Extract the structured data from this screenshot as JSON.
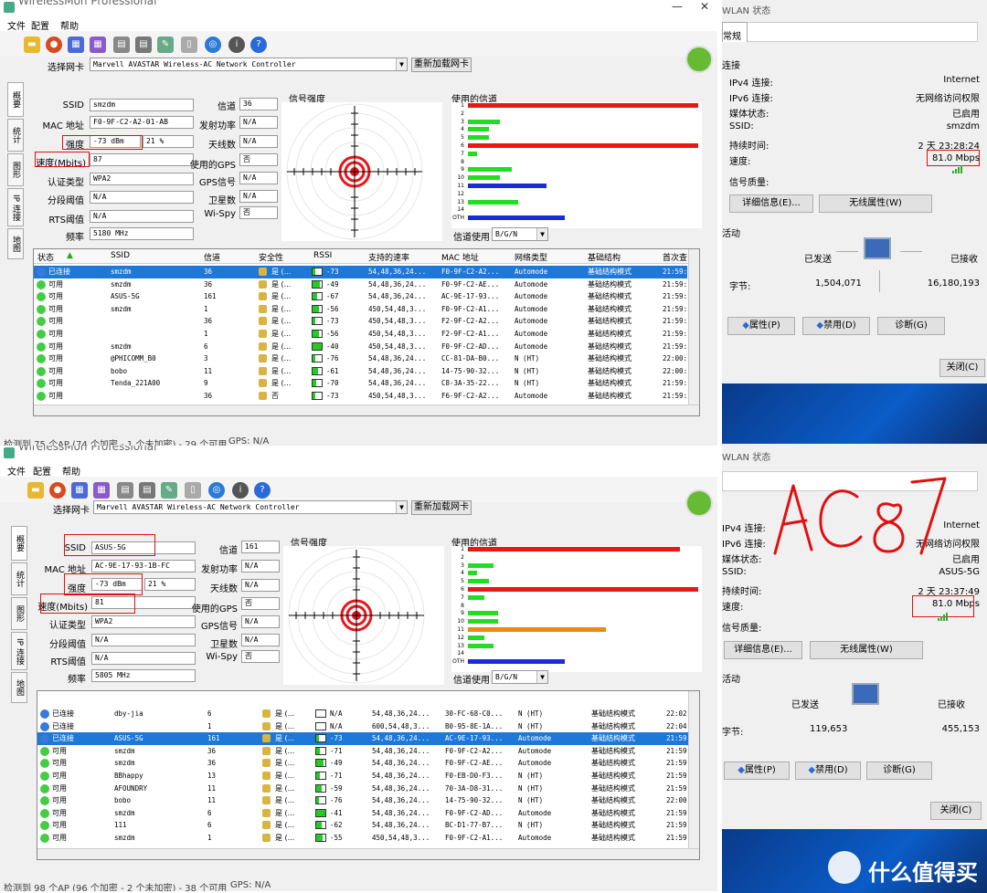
{
  "top": {
    "title": "WirelessMon Professional",
    "menu": [
      "文件",
      "配置",
      "帮助"
    ],
    "adapter_label": "选择网卡",
    "adapter": "Marvell AVASTAR Wireless-AC Network Controller",
    "reload": "重新加载网卡",
    "tabs": [
      "概要",
      "统计",
      "图形",
      "IP 连接",
      "地图"
    ],
    "labels": {
      "ssid": "SSID",
      "mac": "MAC 地址",
      "strength": "强度",
      "speed": "速度(Mbits)",
      "auth": "认证类型",
      "frag": "分段阈值",
      "rts": "RTS阈值",
      "freq": "频率",
      "channel": "信道",
      "txpower": "发射功率",
      "antenna": "天线数",
      "gps_used": "使用的GPS",
      "gps_signal": "GPS信号",
      "satellites": "卫星数",
      "wispy": "Wi-Spy",
      "signal": "信号强度",
      "channels_used": "使用的信道",
      "chan_use": "信道使用"
    },
    "values": {
      "ssid": "smzdm",
      "mac": "F0-9F-C2-A2-01-AB",
      "strength": "-73 dBm",
      "strength_pct": "21 %",
      "speed": "87",
      "auth": "WPA2",
      "frag": "N/A",
      "rts": "N/A",
      "freq": "5180 MHz",
      "channel": "36",
      "txpower": "N/A",
      "antenna": "N/A",
      "gps_used": "否",
      "gps_signal": "N/A",
      "satellites": "N/A",
      "wispy": "否",
      "chan_mode": "B/G/N"
    },
    "columns": [
      "状态",
      "SSID",
      "信道",
      "安全性",
      "RSSI",
      "支持的速率",
      "MAC 地址",
      "网络类型",
      "基础结构",
      "首次查"
    ],
    "rows": [
      {
        "status": "已连接",
        "ssid": "smzdm",
        "ch": "36",
        "sec": "是 (...",
        "rssi": "-73",
        "rates": "54,48,36,24...",
        "mac": "F0-9F-C2-A2...",
        "type": "Automode",
        "infra": "基础结构模式",
        "first": "21:59:"
      },
      {
        "status": "可用",
        "ssid": "smzdm",
        "ch": "36",
        "sec": "是 (...",
        "rssi": "-49",
        "rates": "54,48,36,24...",
        "mac": "F0-9F-C2-AE...",
        "type": "Automode",
        "infra": "基础结构模式",
        "first": "21:59:"
      },
      {
        "status": "可用",
        "ssid": "ASUS-5G",
        "ch": "161",
        "sec": "是 (...",
        "rssi": "-67",
        "rates": "54,48,36,24...",
        "mac": "AC-9E-17-93...",
        "type": "Automode",
        "infra": "基础结构模式",
        "first": "21:59:"
      },
      {
        "status": "可用",
        "ssid": "smzdm",
        "ch": "1",
        "sec": "是 (...",
        "rssi": "-56",
        "rates": "450,54,48,3...",
        "mac": "F0-9F-C2-A1...",
        "type": "Automode",
        "infra": "基础结构模式",
        "first": "21:59:"
      },
      {
        "status": "可用",
        "ssid": "",
        "ch": "36",
        "sec": "是 (...",
        "rssi": "-73",
        "rates": "450,54,48,3...",
        "mac": "F2-9F-C2-A2...",
        "type": "Automode",
        "infra": "基础结构模式",
        "first": "21:59:"
      },
      {
        "status": "可用",
        "ssid": "",
        "ch": "1",
        "sec": "是 (...",
        "rssi": "-56",
        "rates": "450,54,48,3...",
        "mac": "F2-9F-C2-A1...",
        "type": "Automode",
        "infra": "基础结构模式",
        "first": "21:59:"
      },
      {
        "status": "可用",
        "ssid": "smzdm",
        "ch": "6",
        "sec": "是 (...",
        "rssi": "-40",
        "rates": "450,54,48,3...",
        "mac": "F0-9F-C2-AD...",
        "type": "Automode",
        "infra": "基础结构模式",
        "first": "21:59:"
      },
      {
        "status": "可用",
        "ssid": "@PHICOMM_B0",
        "ch": "3",
        "sec": "是 (...",
        "rssi": "-76",
        "rates": "54,48,36,24...",
        "mac": "CC-81-DA-B0...",
        "type": "N (HT)",
        "infra": "基础结构模式",
        "first": "22:00:"
      },
      {
        "status": "可用",
        "ssid": "bobo",
        "ch": "11",
        "sec": "是 (...",
        "rssi": "-61",
        "rates": "54,48,36,24...",
        "mac": "14-75-90-32...",
        "type": "N (HT)",
        "infra": "基础结构模式",
        "first": "22:00:"
      },
      {
        "status": "可用",
        "ssid": "Tenda_221A00",
        "ch": "9",
        "sec": "是 (...",
        "rssi": "-70",
        "rates": "54,48,36,24...",
        "mac": "C8-3A-35-22...",
        "type": "N (HT)",
        "infra": "基础结构模式",
        "first": "21:59:"
      },
      {
        "status": "可用",
        "ssid": "",
        "ch": "36",
        "sec": "否",
        "rssi": "-73",
        "rates": "450,54,48,3...",
        "mac": "F6-9F-C2-A2...",
        "type": "Automode",
        "infra": "基础结构模式",
        "first": "21:59:"
      }
    ],
    "status": "检测到 75 个AP (74 个加密 - 1 个未加密) - 29 个可用",
    "gps": "GPS: N/A"
  },
  "bottom": {
    "title": "WirelessMon Professional",
    "menu": [
      "文件",
      "配置",
      "帮助"
    ],
    "adapter_label": "选择网卡",
    "adapter": "Marvell AVASTAR Wireless-AC Network Controller",
    "reload": "重新加载网卡",
    "values": {
      "ssid": "ASUS-5G",
      "mac": "AC-9E-17-93-1B-FC",
      "strength": "-73 dBm",
      "strength_pct": "21 %",
      "speed": "81",
      "auth": "WPA2",
      "frag": "N/A",
      "rts": "N/A",
      "freq": "5805 MHz",
      "channel": "161",
      "txpower": "N/A",
      "antenna": "N/A",
      "gps_used": "否",
      "gps_signal": "N/A",
      "satellites": "N/A",
      "wispy": "否",
      "chan_mode": "B/G/N"
    },
    "rows": [
      {
        "status": "已连接",
        "ssid": "dby-jia",
        "ch": "6",
        "sec": "是 (...",
        "rssi": "N/A",
        "rates": "54,48,36,24...",
        "mac": "30-FC-68-C0...",
        "type": "N (HT)",
        "infra": "基础结构模式",
        "first": "22:02:"
      },
      {
        "status": "已连接",
        "ssid": "",
        "ch": "1",
        "sec": "是 (...",
        "rssi": "N/A",
        "rates": "600,54,48,3...",
        "mac": "B0-95-8E-1A...",
        "type": "N (HT)",
        "infra": "基础结构模式",
        "first": "22:04:"
      },
      {
        "status": "已连接",
        "ssid": "ASUS-5G",
        "ch": "161",
        "sec": "是 (...",
        "rssi": "-73",
        "rates": "54,48,36,24...",
        "mac": "AC-9E-17-93...",
        "type": "Automode",
        "infra": "基础结构模式",
        "first": "21:59:"
      },
      {
        "status": "可用",
        "ssid": "smzdm",
        "ch": "36",
        "sec": "是 (...",
        "rssi": "-71",
        "rates": "54,48,36,24...",
        "mac": "F0-9F-C2-A2...",
        "type": "Automode",
        "infra": "基础结构模式",
        "first": "21:59:"
      },
      {
        "status": "可用",
        "ssid": "smzdm",
        "ch": "36",
        "sec": "是 (...",
        "rssi": "-49",
        "rates": "54,48,36,24...",
        "mac": "F0-9F-C2-AE...",
        "type": "Automode",
        "infra": "基础结构模式",
        "first": "21:59:"
      },
      {
        "status": "可用",
        "ssid": "BBhappy",
        "ch": "13",
        "sec": "是 (...",
        "rssi": "-71",
        "rates": "54,48,36,24...",
        "mac": "F0-EB-D0-F3...",
        "type": "N (HT)",
        "infra": "基础结构模式",
        "first": "21:59:"
      },
      {
        "status": "可用",
        "ssid": "AFOUNDRY",
        "ch": "11",
        "sec": "是 (...",
        "rssi": "-59",
        "rates": "54,48,36,24...",
        "mac": "70-3A-D8-31...",
        "type": "N (HT)",
        "infra": "基础结构模式",
        "first": "21:59:"
      },
      {
        "status": "可用",
        "ssid": "bobo",
        "ch": "11",
        "sec": "是 (...",
        "rssi": "-76",
        "rates": "54,48,36,24...",
        "mac": "14-75-90-32...",
        "type": "N (HT)",
        "infra": "基础结构模式",
        "first": "22:00:"
      },
      {
        "status": "可用",
        "ssid": "smzdm",
        "ch": "6",
        "sec": "是 (...",
        "rssi": "-41",
        "rates": "54,48,36,24...",
        "mac": "F0-9F-C2-AD...",
        "type": "Automode",
        "infra": "基础结构模式",
        "first": "21:59:"
      },
      {
        "status": "可用",
        "ssid": "111",
        "ch": "6",
        "sec": "是 (...",
        "rssi": "-62",
        "rates": "54,48,36,24...",
        "mac": "BC-D1-77-B7...",
        "type": "N (HT)",
        "infra": "基础结构模式",
        "first": "21:59:"
      },
      {
        "status": "可用",
        "ssid": "smzdm",
        "ch": "1",
        "sec": "是 (...",
        "rssi": "-55",
        "rates": "450,54,48,3...",
        "mac": "F0-9F-C2-A1...",
        "type": "Automode",
        "infra": "基础结构模式",
        "first": "21:59:"
      }
    ],
    "status": "检测到 98 个AP (96 个加密 - 2 个未加密) - 38 个可用",
    "gps": "GPS: N/A"
  },
  "wlan_top": {
    "title": "WLAN 状态",
    "tab": "常规",
    "section_conn": "连接",
    "labels": [
      "IPv4 连接:",
      "IPv6 连接:",
      "媒体状态:",
      "SSID:",
      "持续时间:",
      "速度:"
    ],
    "values": [
      "Internet",
      "无网络访问权限",
      "已启用",
      "smzdm",
      "2 天 23:28:24",
      "81.0 Mbps"
    ],
    "quality": "信号质量:",
    "details": "详细信息(E)...",
    "wireless_props": "无线属性(W)",
    "activity": "活动",
    "sent": "已发送",
    "received": "已接收",
    "bytes_label": "字节:",
    "bytes_sent": "1,504,071",
    "bytes_recv": "16,180,193",
    "props": "属性(P)",
    "disable": "禁用(D)",
    "diagnose": "诊断(G)",
    "close": "关闭(C)"
  },
  "wlan_bottom": {
    "title": "WLAN 状态",
    "labels": [
      "IPv4 连接:",
      "IPv6 连接:",
      "媒体状态:",
      "SSID:",
      "持续时间:",
      "速度:"
    ],
    "values": [
      "Internet",
      "无网络访问权限",
      "已启用",
      "ASUS-5G",
      "2 天 23:37:49",
      "81.0 Mbps"
    ],
    "quality": "信号质量:",
    "details": "详细信息(E)...",
    "wireless_props": "无线属性(W)",
    "activity": "活动",
    "sent": "已发送",
    "received": "已接收",
    "bytes_label": "字节:",
    "bytes_sent": "119,653",
    "bytes_recv": "455,153",
    "props": "属性(P)",
    "disable": "禁用(D)",
    "diagnose": "诊断(G)",
    "close": "关闭(C)"
  },
  "annotation": "AC87",
  "watermark": "什么值得买",
  "channel_bars_top": [
    {
      "ch": "1",
      "pct": 1.0,
      "color": "#e81818"
    },
    {
      "ch": "2",
      "pct": 0,
      "color": "#22dd22"
    },
    {
      "ch": "3",
      "pct": 0.14,
      "color": "#22dd22"
    },
    {
      "ch": "4",
      "pct": 0.09,
      "color": "#22dd22"
    },
    {
      "ch": "5",
      "pct": 0.09,
      "color": "#22dd22"
    },
    {
      "ch": "6",
      "pct": 1.0,
      "color": "#e81818"
    },
    {
      "ch": "7",
      "pct": 0.04,
      "color": "#22dd22"
    },
    {
      "ch": "8",
      "pct": 0,
      "color": "#22dd22"
    },
    {
      "ch": "9",
      "pct": 0.19,
      "color": "#22dd22"
    },
    {
      "ch": "10",
      "pct": 0.14,
      "color": "#22dd22"
    },
    {
      "ch": "11",
      "pct": 0.34,
      "color": "#1a2cd8"
    },
    {
      "ch": "12",
      "pct": 0,
      "color": "#22dd22"
    },
    {
      "ch": "13",
      "pct": 0.22,
      "color": "#22dd22"
    },
    {
      "ch": "14",
      "pct": 0,
      "color": "#22dd22"
    },
    {
      "ch": "OTH",
      "pct": 0.42,
      "color": "#1a2cd8"
    }
  ],
  "channel_bars_bottom": [
    {
      "ch": "1",
      "pct": 0.92,
      "color": "#e81818"
    },
    {
      "ch": "2",
      "pct": 0,
      "color": "#22dd22"
    },
    {
      "ch": "3",
      "pct": 0.11,
      "color": "#22dd22"
    },
    {
      "ch": "4",
      "pct": 0.04,
      "color": "#22dd22"
    },
    {
      "ch": "5",
      "pct": 0.09,
      "color": "#22dd22"
    },
    {
      "ch": "6",
      "pct": 1.0,
      "color": "#e81818"
    },
    {
      "ch": "7",
      "pct": 0.07,
      "color": "#22dd22"
    },
    {
      "ch": "8",
      "pct": 0,
      "color": "#22dd22"
    },
    {
      "ch": "9",
      "pct": 0.13,
      "color": "#22dd22"
    },
    {
      "ch": "10",
      "pct": 0.13,
      "color": "#22dd22"
    },
    {
      "ch": "11",
      "pct": 0.6,
      "color": "#e88a1a"
    },
    {
      "ch": "12",
      "pct": 0.07,
      "color": "#22dd22"
    },
    {
      "ch": "13",
      "pct": 0.11,
      "color": "#22dd22"
    },
    {
      "ch": "14",
      "pct": 0,
      "color": "#22dd22"
    },
    {
      "ch": "OTH",
      "pct": 0.42,
      "color": "#1a2cd8"
    }
  ]
}
